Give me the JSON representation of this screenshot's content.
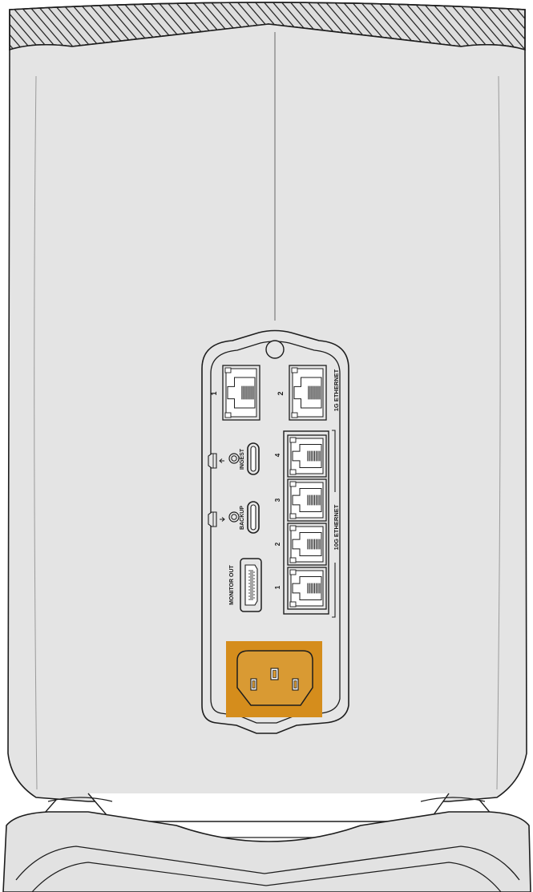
{
  "colors": {
    "body": "#e3e3e3",
    "outline": "#1d1d1d",
    "panel": "#e6e6e6",
    "power_highlight": "#d58d1c",
    "power_socket": "#d99a33"
  },
  "labels": {
    "port_1g_1": "1",
    "port_1g_2": "2",
    "group_1g": "1G ETHERNET",
    "ingest_label": "INGEST",
    "backup_label": "BACKUP",
    "monitor_out": "MONITOR OUT",
    "port_10g_4": "4",
    "port_10g_3": "3",
    "port_10g_2": "2",
    "port_10g_1": "1",
    "group_10g": "10G ETHERNET"
  },
  "icons": {
    "ingest_icon": "drive-ingest-icon",
    "backup_icon": "drive-backup-icon",
    "hdmi_icon": "hdmi-port-icon",
    "power_icon": "iec-power-inlet-icon"
  }
}
